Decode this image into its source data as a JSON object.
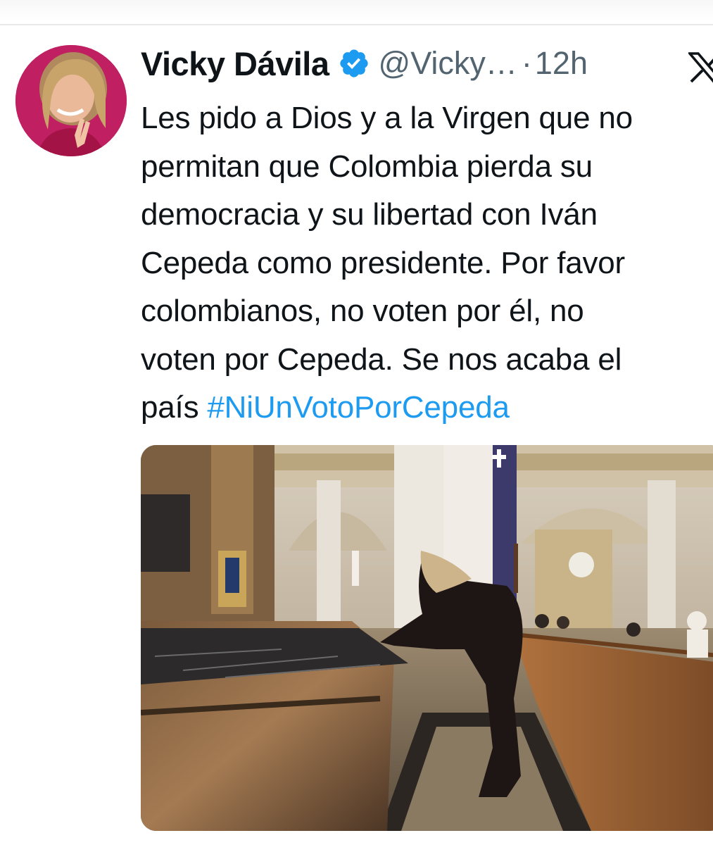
{
  "tweet": {
    "author": {
      "display_name": "Vicky Dávila",
      "handle": "@Vicky…",
      "verified": true
    },
    "separator": "·",
    "timestamp": "12h",
    "text_lines": [
      "Les pido a Dios y a la Virgen que no",
      "permitan que Colombia pierda su",
      "democracia y su libertad con Iván",
      "Cepeda como presidente. Por favor",
      "colombianos, no voten por él, no",
      "voten por Cepeda. Se nos acaba el"
    ],
    "last_line_prefix": "país ",
    "hashtag": "#NiUnVotoPorCepeda",
    "icons": {
      "verified": "verified-badge-icon",
      "platform": "x-logo-icon"
    },
    "colors": {
      "text": "#0f1419",
      "secondary": "#536471",
      "link": "#1d9bf0",
      "verified": "#1d9bf0"
    }
  }
}
